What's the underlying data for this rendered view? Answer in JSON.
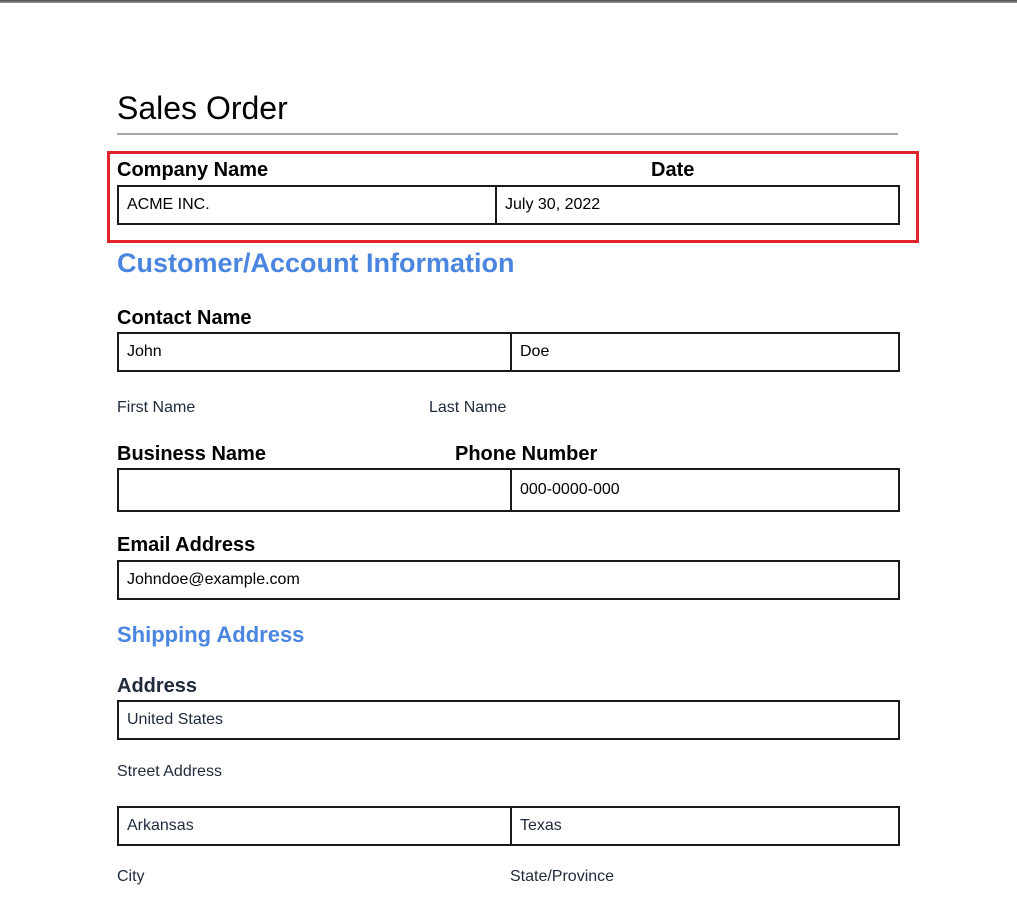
{
  "title": "Sales Order",
  "company_section": {
    "company_label": "Company Name",
    "date_label": "Date",
    "company_value": "ACME  INC.",
    "date_value": "July 30, 2022"
  },
  "customer_section": {
    "heading": "Customer/Account Information",
    "contact_label": "Contact Name",
    "first_name_value": "John",
    "last_name_value": "Doe",
    "first_name_sublabel": "First Name",
    "last_name_sublabel": "Last Name",
    "business_label": "Business Name",
    "phone_label": "Phone Number",
    "business_value": "",
    "phone_value": "000-0000-000",
    "email_label": "Email Address",
    "email_value": "Johndoe@example.com"
  },
  "shipping_section": {
    "heading": "Shipping Address",
    "address_label": "Address",
    "street_value": "United States",
    "street_sublabel": "Street Address",
    "city_value": "Arkansas",
    "state_value": "Texas",
    "city_sublabel": "City",
    "state_sublabel": "State/Province"
  },
  "colors": {
    "section_heading": "#4a86e0",
    "highlight_border": "#e0242c",
    "field_border": "#1a1a1a"
  }
}
